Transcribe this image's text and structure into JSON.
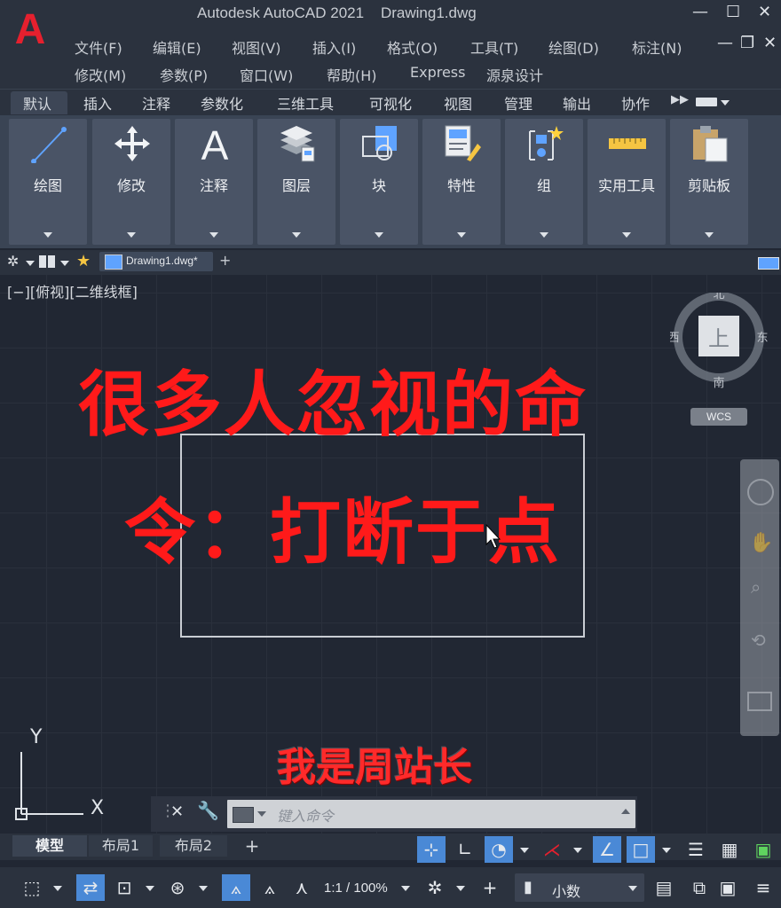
{
  "window": {
    "app_title": "Autodesk AutoCAD 2021",
    "doc_title": "Drawing1.dwg",
    "minimize": "—",
    "maximize": "☐",
    "close": "✕"
  },
  "app_logo": "A",
  "menu": {
    "row1": [
      "文件(F)",
      "编辑(E)",
      "视图(V)",
      "插入(I)",
      "格式(O)",
      "工具(T)",
      "绘图(D)",
      "标注(N)"
    ],
    "row2": [
      "修改(M)",
      "参数(P)",
      "窗口(W)",
      "帮助(H)",
      "Express",
      "源泉设计"
    ]
  },
  "ribbon_tabs": [
    "默认",
    "插入",
    "注释",
    "参数化",
    "三维工具",
    "可视化",
    "视图",
    "管理",
    "输出",
    "协作"
  ],
  "ribbon_panels": [
    "绘图",
    "修改",
    "注释",
    "图层",
    "块",
    "特性",
    "组",
    "实用工具",
    "剪贴板"
  ],
  "document_tab": "Drawing1.dwg*",
  "add_tab": "+",
  "viewport_label": "[−][俯视][二维线框]",
  "overlay": {
    "line1": "很多人忽视的命",
    "line2": "令：打断于点",
    "subtitle": "我是周站长"
  },
  "viewcube": {
    "north": "北",
    "south": "南",
    "east": "东",
    "west": "西",
    "face": "上",
    "wcs": "WCS"
  },
  "ucs": {
    "y_label": "Y",
    "x_label": "X"
  },
  "command_line": {
    "placeholder": "键入命令"
  },
  "layout_tabs": [
    "模型",
    "布局1",
    "布局2"
  ],
  "layout_add": "+",
  "status": {
    "scale": "1:1 / 100%",
    "units": "小数"
  },
  "colors": {
    "overlay_text": "#ff1a1a",
    "status_active": "#4a89d6",
    "logo": "#e5202e"
  }
}
